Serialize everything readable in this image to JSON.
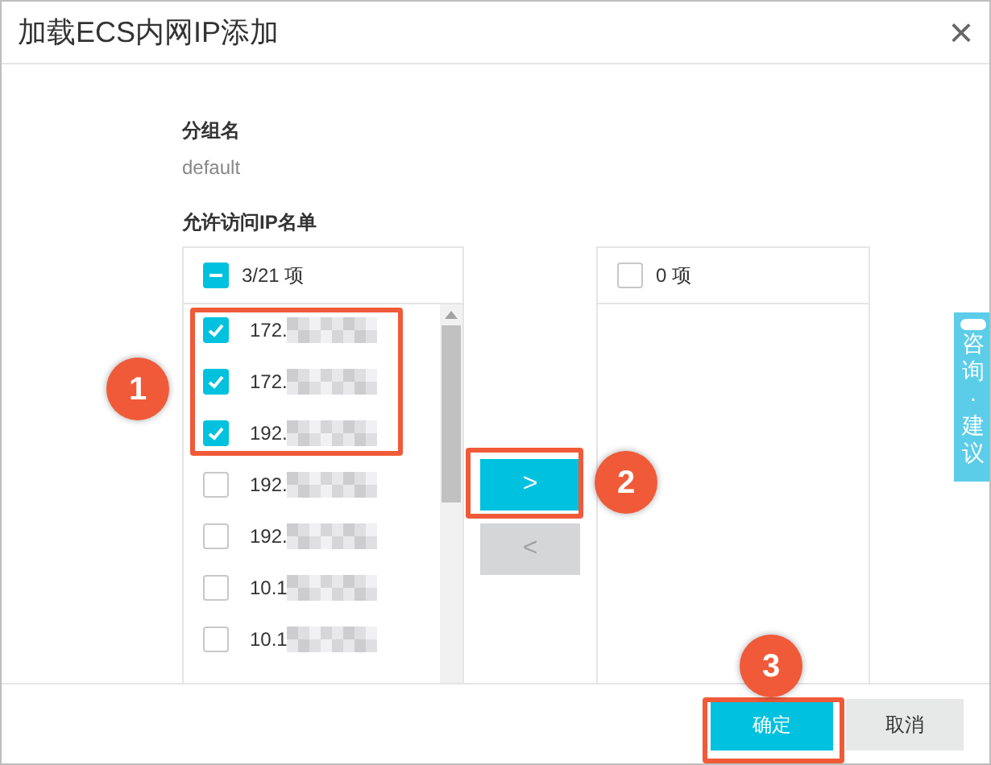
{
  "dialog": {
    "title": "加载ECS内网IP添加",
    "close": "×"
  },
  "group": {
    "label": "分组名",
    "value": "default"
  },
  "whitelist": {
    "label": "允许访问IP名单"
  },
  "source_list": {
    "header": "3/21 项",
    "indeterminate": true,
    "items": [
      {
        "text": "172.",
        "checked": true
      },
      {
        "text": "172.",
        "checked": true
      },
      {
        "text": "192.",
        "checked": true
      },
      {
        "text": "192.",
        "checked": false
      },
      {
        "text": "192.",
        "checked": false
      },
      {
        "text": "10.1",
        "checked": false
      },
      {
        "text": "10.1",
        "checked": false
      }
    ]
  },
  "move_buttons": [
    {
      "label": ">",
      "disabled": false
    },
    {
      "label": "<",
      "disabled": true
    }
  ],
  "target_list": {
    "header": "0 项",
    "indeterminate": false
  },
  "side_tab": {
    "chars": [
      "咨",
      "询",
      "·",
      "建",
      "议"
    ]
  },
  "footer": {
    "buttons": [
      {
        "label": "确定",
        "kind": "primary"
      },
      {
        "label": "取消",
        "kind": "secondary"
      }
    ]
  },
  "annotations": [
    {
      "label": "1"
    },
    {
      "label": "2"
    },
    {
      "label": "3"
    }
  ]
}
